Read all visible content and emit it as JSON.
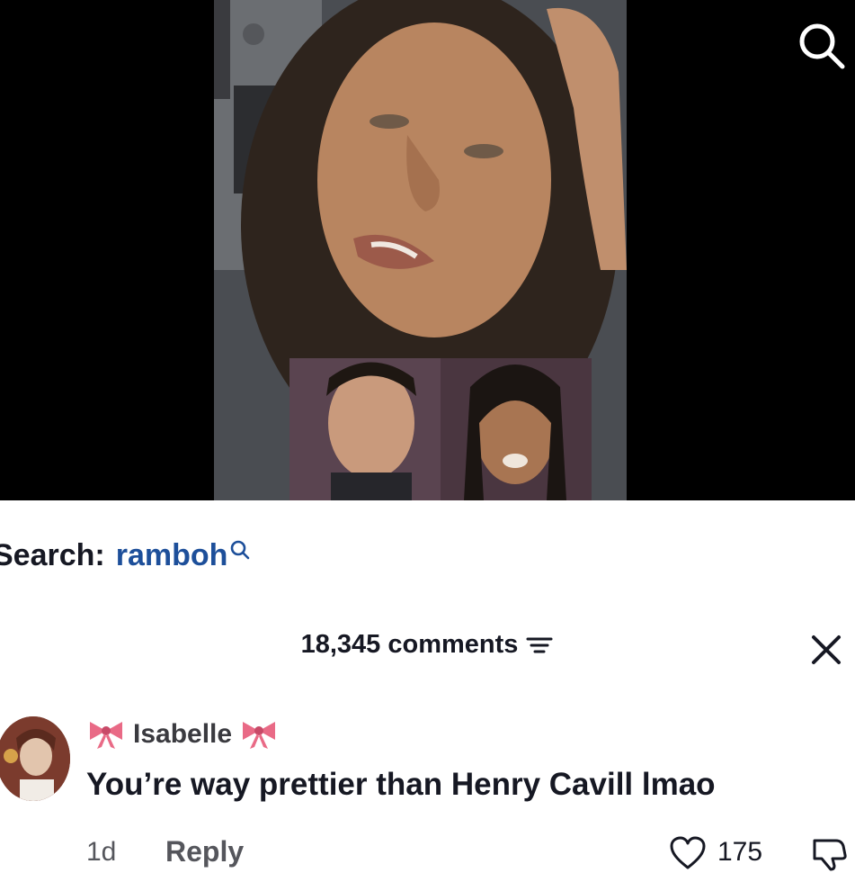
{
  "search": {
    "prefix": "Search:",
    "term": "ramboh"
  },
  "comments": {
    "count_label": "18,345 comments"
  },
  "comment": {
    "username": "Isabelle",
    "text": "You’re way prettier than Henry Cavill lmao",
    "time": "1d",
    "reply_label": "Reply",
    "likes": "175"
  },
  "icons": {
    "top_search": "search-icon",
    "filter": "filter-icon",
    "close": "close-icon",
    "bow": "ribbon-bow-icon",
    "heart": "heart-icon",
    "dislike": "dislike-icon"
  },
  "colors": {
    "search_term": "#1d4f9a",
    "bow": "#e05a78"
  }
}
